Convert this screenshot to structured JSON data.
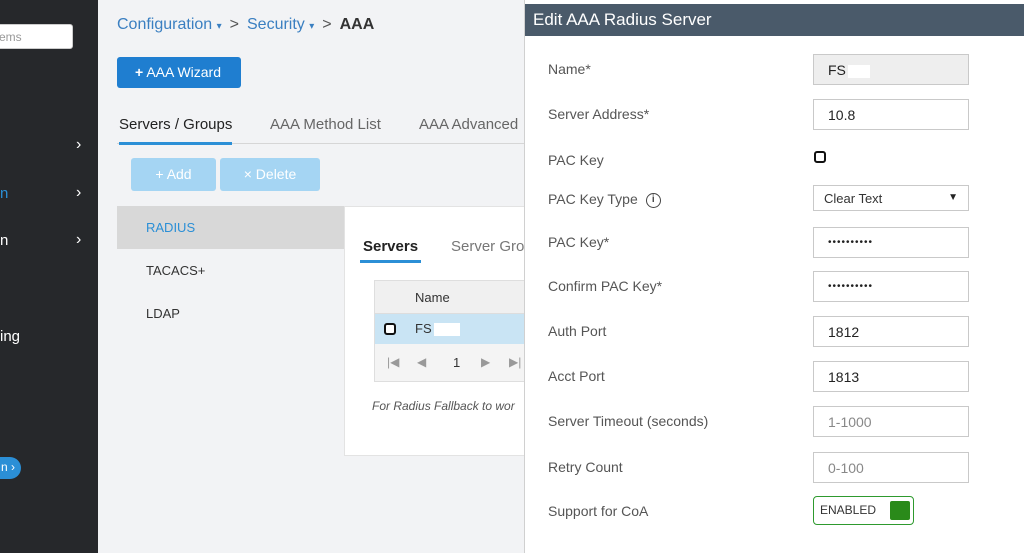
{
  "sidebar": {
    "search_placeholder": "ems",
    "items": [
      {
        "label": "",
        "chevron": "›"
      },
      {
        "label": "n",
        "chevron": "›"
      },
      {
        "label": "n",
        "chevron": "›"
      },
      {
        "label": "ing",
        "chevron": ""
      }
    ],
    "pill_label": "n ›"
  },
  "breadcrumb": {
    "items": [
      "Configuration",
      "Security",
      "AAA"
    ],
    "caret": "▾",
    "separator": ">"
  },
  "wizard_button": {
    "icon": "+",
    "label": "AAA Wizard"
  },
  "tabs": [
    "Servers / Groups",
    "AAA Method List",
    "AAA Advanced"
  ],
  "toolbar": {
    "add_icon": "+",
    "add_label": "Add",
    "delete_icon": "×",
    "delete_label": "Delete"
  },
  "server_types": [
    "RADIUS",
    "TACACS+",
    "LDAP"
  ],
  "subtabs": [
    "Servers",
    "Server Groups"
  ],
  "grid": {
    "header": "Name",
    "rows": [
      {
        "name": "FS"
      }
    ],
    "pager": {
      "first": "|◀",
      "prev": "◀",
      "page": "1",
      "next": "▶",
      "last": "▶|"
    }
  },
  "fallback_text": "For Radius Fallback to wor",
  "edit_panel": {
    "title": "Edit AAA Radius Server",
    "fields": {
      "name": {
        "label": "Name*",
        "value": "FS"
      },
      "server_address": {
        "label": "Server Address*",
        "value": "10.8"
      },
      "pac_key": {
        "label": "PAC Key"
      },
      "pac_key_type": {
        "label": "PAC Key Type",
        "value": "Clear Text",
        "info_icon": "i",
        "arrow": "▼"
      },
      "pac_key_value": {
        "label": "PAC Key*",
        "value": "••••••••••"
      },
      "confirm_pac_key": {
        "label": "Confirm PAC Key*",
        "value": "••••••••••"
      },
      "auth_port": {
        "label": "Auth Port",
        "value": "1812"
      },
      "acct_port": {
        "label": "Acct Port",
        "value": "1813"
      },
      "server_timeout": {
        "label": "Server Timeout (seconds)",
        "placeholder": "1-1000"
      },
      "retry_count": {
        "label": "Retry Count",
        "placeholder": "0-100"
      },
      "support_coa": {
        "label": "Support for CoA",
        "value": "ENABLED"
      }
    }
  },
  "colors": {
    "sidebar_bg": "#26282b",
    "primary_blue": "#1f7ed0",
    "header_bg": "#4a5a6a",
    "toggle_green": "#2a8a1a"
  }
}
